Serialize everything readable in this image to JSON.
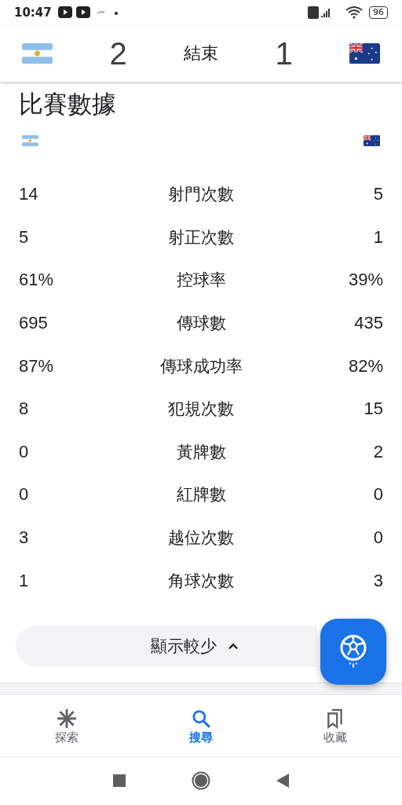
{
  "status_bar": {
    "time": "10:47",
    "battery": "96"
  },
  "header": {
    "home_score": "2",
    "status": "結束",
    "away_score": "1"
  },
  "section_title": "比賽數據",
  "stats": [
    {
      "home": "14",
      "label": "射門次數",
      "away": "5"
    },
    {
      "home": "5",
      "label": "射正次數",
      "away": "1"
    },
    {
      "home": "61%",
      "label": "控球率",
      "away": "39%"
    },
    {
      "home": "695",
      "label": "傳球數",
      "away": "435"
    },
    {
      "home": "87%",
      "label": "傳球成功率",
      "away": "82%"
    },
    {
      "home": "8",
      "label": "犯規次數",
      "away": "15"
    },
    {
      "home": "0",
      "label": "黃牌數",
      "away": "2"
    },
    {
      "home": "0",
      "label": "紅牌數",
      "away": "0"
    },
    {
      "home": "3",
      "label": "越位次數",
      "away": "0"
    },
    {
      "home": "1",
      "label": "角球次數",
      "away": "3"
    }
  ],
  "toggle_button": {
    "label": "顯示較少",
    "expanded": true
  },
  "bottom_nav": [
    {
      "label": "探索",
      "kind": "explore",
      "selected": false
    },
    {
      "label": "搜尋",
      "kind": "search",
      "selected": true
    },
    {
      "label": "收藏",
      "kind": "saved",
      "selected": false
    }
  ]
}
